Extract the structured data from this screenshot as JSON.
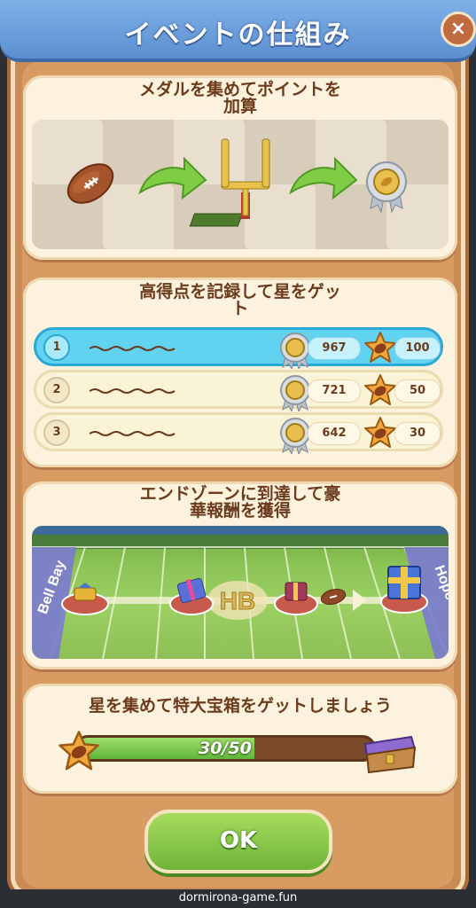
{
  "header": {
    "title": "イベントの仕組み",
    "close_symbol": "×"
  },
  "card_medals": {
    "title_line1": "メダルを集めてポイントを",
    "title_line2": "加算",
    "icons": [
      "football-icon",
      "arrow-right-icon",
      "goal-post-icon",
      "arrow-right-icon",
      "medal-icon"
    ]
  },
  "card_leaderboard": {
    "title_line1": "高得点を記録して星をゲッ",
    "title_line2": "ト",
    "rows": [
      {
        "rank": "1",
        "points": "967",
        "stars": "100"
      },
      {
        "rank": "2",
        "points": "721",
        "stars": "50"
      },
      {
        "rank": "3",
        "points": "642",
        "stars": "30"
      }
    ]
  },
  "card_endzone": {
    "title_line1": "エンドゾーンに到達して豪",
    "title_line2": "華報酬を獲得",
    "field_left_sign": "Bell Bay",
    "field_right_sign": "Hope",
    "field_center_logo": "HB"
  },
  "card_stars": {
    "title": "星を集めて特大宝箱をゲットしましょう",
    "progress_text": "30/50",
    "progress_value": 30,
    "progress_max": 50
  },
  "ok_button": {
    "label": "OK"
  },
  "footer": {
    "watermark": "dormirona-game.fun"
  },
  "colors": {
    "title_bar": "#6a9fdf",
    "panel": "#c98a55",
    "card": "#fcf2dd",
    "highlight_row": "#62d2f1",
    "ok_green": "#8cc84a"
  }
}
